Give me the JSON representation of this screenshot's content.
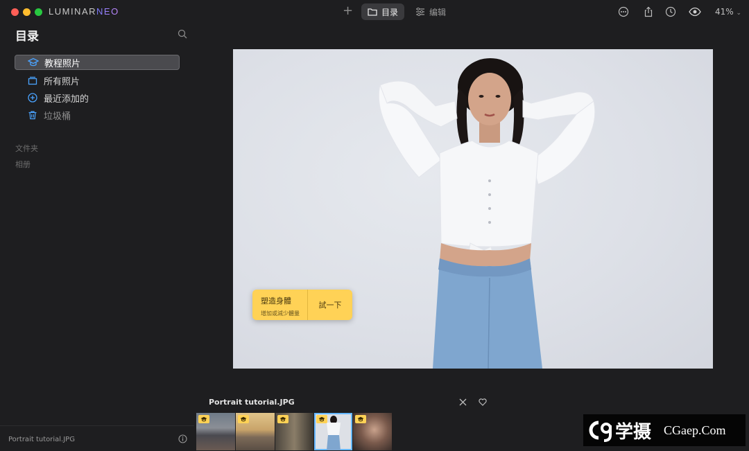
{
  "app": {
    "logo_main": "LUMINAR",
    "logo_accent": "NEO"
  },
  "toolbar": {
    "tab_catalog": "目录",
    "tab_edit": "编辑",
    "zoom": "41%"
  },
  "sidebar": {
    "title": "目录",
    "items": [
      {
        "label": "教程照片",
        "icon": "graduation-cap-icon"
      },
      {
        "label": "所有照片",
        "icon": "photo-stack-icon"
      },
      {
        "label": "最近添加的",
        "icon": "plus-circle-icon"
      },
      {
        "label": "垃圾桶",
        "icon": "trash-icon"
      }
    ],
    "sections": {
      "folders": "文件夹",
      "albums": "相册"
    },
    "footer_filename": "Portrait tutorial.JPG"
  },
  "promo": {
    "title": "塑造身體",
    "subtitle": "增加或減少體量",
    "button": "試一下"
  },
  "filmstrip": {
    "filename": "Portrait tutorial.JPG",
    "thumbnails": [
      "harbor",
      "beach",
      "street",
      "portrait",
      "woman"
    ],
    "selected_index": 3
  },
  "watermark": {
    "cn": "学摄",
    "domain": "CGaep.Com"
  },
  "colors": {
    "accent_blue": "#66b8ff",
    "promo_yellow": "#ffd256",
    "icon_blue": "#4aa3ff"
  }
}
